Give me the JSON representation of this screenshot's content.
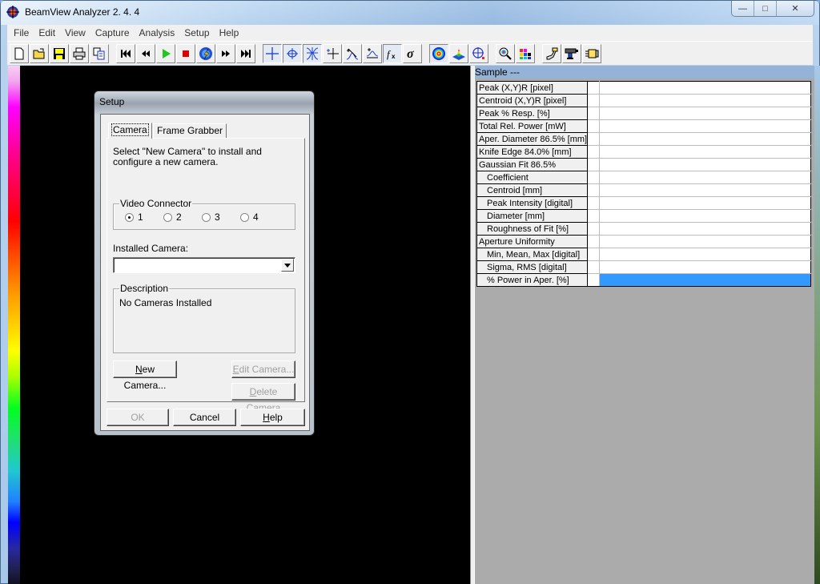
{
  "window": {
    "title": "BeamView Analyzer 2. 4. 4",
    "controls": {
      "minimize": "—",
      "maximize": "□",
      "close": "✕"
    }
  },
  "menubar": [
    "File",
    "Edit",
    "View",
    "Capture",
    "Analysis",
    "Setup",
    "Help"
  ],
  "toolbar": {
    "groups": [
      [
        "new-file-icon",
        "open-folder-icon",
        "save-icon",
        "print-icon",
        "copy-icon"
      ],
      [
        "first-frame-icon",
        "rewind-icon",
        "play-icon",
        "stop-icon",
        "capture-icon",
        "fast-forward-icon",
        "last-frame-icon"
      ],
      [
        "crosshair-icon",
        "centroid-icon",
        "knife-edge-icon",
        "peak-cross-icon",
        "profile-x-icon",
        "profile-fit-icon",
        "function-icon",
        "sigma-icon"
      ],
      [
        "beam-2d-icon",
        "beam-3d-icon",
        "aperture-icon"
      ],
      [
        "zoom-icon",
        "palette-icon"
      ],
      [
        "camera-mount-icon",
        "camera-icon",
        "frame-grabber-icon"
      ]
    ],
    "pressed": [
      "crosshair-icon",
      "centroid-icon",
      "knife-edge-icon",
      "function-icon",
      "beam-2d-icon"
    ]
  },
  "results": {
    "header": "Sample  ---",
    "rows": [
      {
        "label": "Peak (X,Y)R [pixel]",
        "sub": false,
        "value": ""
      },
      {
        "label": "Centroid (X,Y)R [pixel]",
        "sub": false,
        "value": ""
      },
      {
        "label": "Peak % Resp. [%]",
        "sub": false,
        "value": ""
      },
      {
        "label": "Total Rel. Power  [mW]",
        "sub": false,
        "value": ""
      },
      {
        "label": "Aper. Diameter 86.5% [mm]",
        "sub": false,
        "value": ""
      },
      {
        "label": "Knife Edge 84.0% [mm]",
        "sub": false,
        "value": ""
      },
      {
        "label": "Gaussian Fit 86.5%",
        "sub": false,
        "value": ""
      },
      {
        "label": "Coefficient",
        "sub": true,
        "value": ""
      },
      {
        "label": "Centroid [mm]",
        "sub": true,
        "value": ""
      },
      {
        "label": "Peak Intensity [digital]",
        "sub": true,
        "value": ""
      },
      {
        "label": "Diameter [mm]",
        "sub": true,
        "value": ""
      },
      {
        "label": "Roughness of Fit [%]",
        "sub": true,
        "value": ""
      },
      {
        "label": "Aperture Uniformity",
        "sub": false,
        "value": ""
      },
      {
        "label": "Min, Mean, Max [digital]",
        "sub": true,
        "value": ""
      },
      {
        "label": "Sigma, RMS [digital]",
        "sub": true,
        "value": ""
      },
      {
        "label": "% Power in Aper.  [%]",
        "sub": true,
        "value": "",
        "selected": true
      }
    ],
    "selection_color": "#3399ff"
  },
  "dialog": {
    "title": "Setup",
    "tabs": [
      {
        "label": "Camera",
        "active": true
      },
      {
        "label": "Frame Grabber",
        "active": false
      }
    ],
    "intro": "Select \"New Camera\" to install and configure a new camera.",
    "video_connector": {
      "legend": "Video Connector",
      "options": [
        "1",
        "2",
        "3",
        "4"
      ],
      "selected": "1"
    },
    "installed_camera": {
      "label": "Installed Camera:",
      "value": ""
    },
    "description": {
      "legend": "Description",
      "text": "No Cameras Installed"
    },
    "buttons": {
      "new_camera": "New Camera...",
      "edit_camera": "Edit Camera...",
      "delete_camera": "Delete Camera",
      "ok": "OK",
      "cancel": "Cancel",
      "help": "Help"
    }
  }
}
